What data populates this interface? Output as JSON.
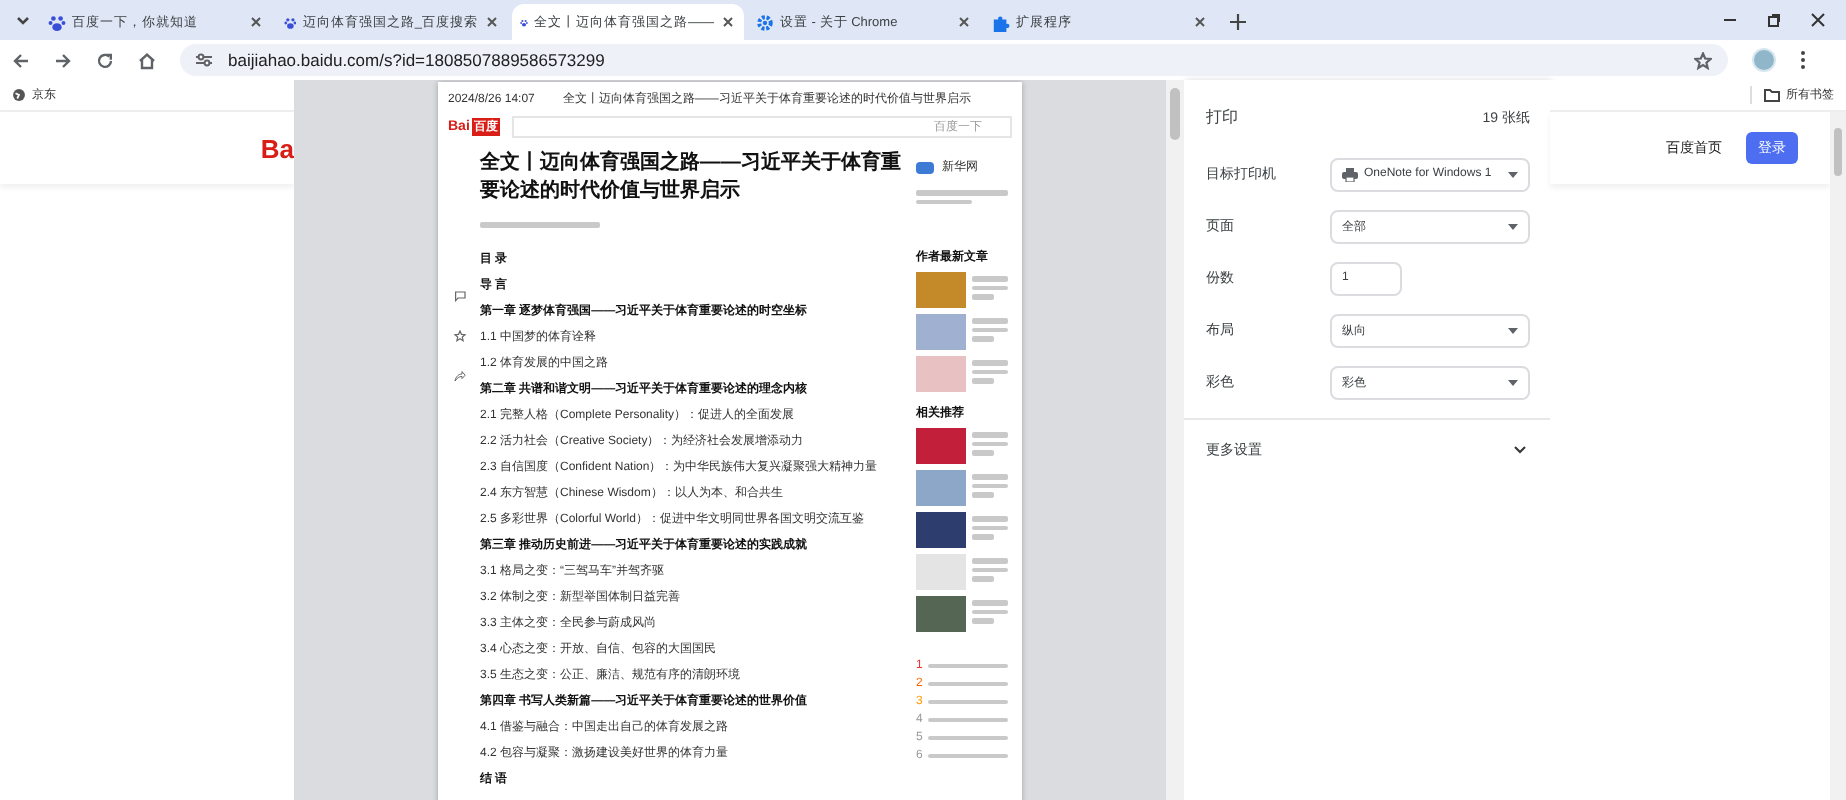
{
  "tabs": [
    {
      "title": "百度一下，你就知道",
      "selected": false,
      "kind": "site"
    },
    {
      "title": "迈向体育强国之路_百度搜索",
      "selected": false,
      "kind": "site"
    },
    {
      "title": "全文丨迈向体育强国之路——",
      "selected": true,
      "kind": "site"
    },
    {
      "title": "设置 - 关于 Chrome",
      "selected": false,
      "kind": "settings"
    },
    {
      "title": "扩展程序",
      "selected": false,
      "kind": "extensions"
    }
  ],
  "address_bar": {
    "url": "baijiahao.baidu.com/s?id=1808507889586573299"
  },
  "bookmarks_bar": {
    "items": [
      "京东"
    ],
    "all_bookmarks": "所有书签"
  },
  "background_page": {
    "logo": "Ba",
    "home_link": "百度首页",
    "login_button": "登录"
  },
  "print_preview": {
    "header_date": "2024/8/26 14:07",
    "header_title": "全文丨迈向体育强国之路——习近平关于体育重要论述的时代价值与世界启示",
    "logo_latin": "Bai",
    "logo_cjk": "百度",
    "search_button": "百度一下",
    "article_title": "全文丨迈向体育强国之路——习近平关于体育重要论述的时代价值与世界启示",
    "author_name": "新华网",
    "sidebar_headings": [
      "作者最新文章",
      "相关推荐"
    ],
    "toc": [
      {
        "kind": "heading",
        "text": "目 录"
      },
      {
        "kind": "heading",
        "text": "导 言"
      },
      {
        "kind": "chapter",
        "text": "第一章 逐梦体育强国——习近平关于体育重要论述的时空坐标"
      },
      {
        "kind": "section",
        "text": "1.1 中国梦的体育诠释"
      },
      {
        "kind": "section",
        "text": "1.2 体育发展的中国之路"
      },
      {
        "kind": "chapter",
        "text": "第二章 共谱和谐文明——习近平关于体育重要论述的理念内核"
      },
      {
        "kind": "section",
        "text": "2.1 完整人格（Complete Personality）：促进人的全面发展"
      },
      {
        "kind": "section",
        "text": "2.2 活力社会（Creative Society）：为经济社会发展增添动力"
      },
      {
        "kind": "section",
        "text": "2.3 自信国度（Confident Nation）：为中华民族伟大复兴凝聚强大精神力量"
      },
      {
        "kind": "section",
        "text": "2.4 东方智慧（Chinese Wisdom）：以人为本、和合共生"
      },
      {
        "kind": "section",
        "text": "2.5 多彩世界（Colorful World）：促进中华文明同世界各国文明交流互鉴"
      },
      {
        "kind": "chapter",
        "text": "第三章 推动历史前进——习近平关于体育重要论述的实践成就"
      },
      {
        "kind": "section",
        "text": "3.1 格局之变：“三驾马车”并驾齐驱"
      },
      {
        "kind": "section",
        "text": "3.2 体制之变：新型举国体制日益完善"
      },
      {
        "kind": "section",
        "text": "3.3 主体之变：全民参与蔚成风尚"
      },
      {
        "kind": "section",
        "text": "3.4 心态之变：开放、自信、包容的大国国民"
      },
      {
        "kind": "section",
        "text": "3.5 生态之变：公正、廉洁、规范有序的清朗环境"
      },
      {
        "kind": "chapter",
        "text": "第四章 书写人类新篇——习近平关于体育重要论述的世界价值"
      },
      {
        "kind": "section",
        "text": "4.1 借鉴与融合：中国走出自己的体育发展之路"
      },
      {
        "kind": "section",
        "text": "4.2 包容与凝聚：激扬建设美好世界的体育力量"
      },
      {
        "kind": "heading",
        "text": "结 语"
      }
    ],
    "hot_list_numbers": [
      "1",
      "2",
      "3",
      "4",
      "5",
      "6"
    ]
  },
  "print_dialog": {
    "title": "打印",
    "sheets": "19 张纸",
    "settings": [
      {
        "label": "目标打印机",
        "kind": "printer",
        "value": "OneNote for Windows 1"
      },
      {
        "label": "页面",
        "kind": "select",
        "value": "全部"
      },
      {
        "label": "份数",
        "kind": "number",
        "value": "1"
      },
      {
        "label": "布局",
        "kind": "select",
        "value": "纵向"
      },
      {
        "label": "彩色",
        "kind": "select",
        "value": "彩色"
      }
    ],
    "more_settings": "更多设置"
  }
}
